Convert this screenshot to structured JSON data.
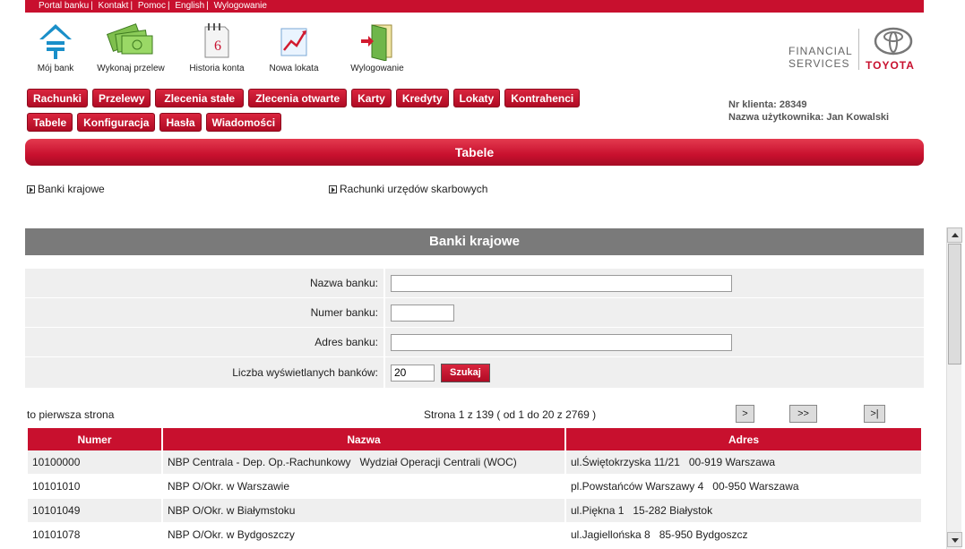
{
  "top_links": [
    "Portal banku",
    "Kontakt",
    "Pomoc",
    "English",
    "Wylogowanie"
  ],
  "icons": [
    {
      "label": "Mój bank",
      "icon": "home-icon"
    },
    {
      "label": "Wykonaj przelew",
      "icon": "money-icon"
    },
    {
      "label": "Historia konta",
      "icon": "calendar-icon"
    },
    {
      "label": "Nowa lokata",
      "icon": "chart-icon"
    },
    {
      "label": "Wylogowanie",
      "icon": "door-icon"
    }
  ],
  "logo": {
    "line1": "FINANCIAL",
    "line2": "SERVICES",
    "brand": "TOYOTA"
  },
  "menu": {
    "row1": [
      "Rachunki",
      "Przelewy",
      "Zlecenia stałe",
      "Zlecenia otwarte",
      "Karty",
      "Kredyty",
      "Lokaty",
      "Kontrahenci"
    ],
    "row2": [
      "Tabele",
      "Konfiguracja",
      "Hasła",
      "Wiadomości"
    ]
  },
  "user": {
    "client_no": "Nr klienta: 28349",
    "username": "Nazwa użytkownika: Jan Kowalski"
  },
  "section_title": "Tabele",
  "sublinks": [
    "Banki krajowe",
    "Rachunki urzędów skarbowych"
  ],
  "panel_title": "Banki krajowe",
  "form": {
    "name_label": "Nazwa banku:",
    "name_value": "",
    "number_label": "Numer banku:",
    "number_value": "",
    "address_label": "Adres banku:",
    "address_value": "",
    "count_label": "Liczba wyświetlanych banków:",
    "count_value": "20",
    "search_label": "Szukaj"
  },
  "pager": {
    "first_text": "to pierwsza strona",
    "info": "Strona 1 z 139 ( od 1 do 20 z 2769 )",
    "next": ">",
    "fast": ">>",
    "last": ">|"
  },
  "table": {
    "headers": [
      "Numer",
      "Nazwa",
      "Adres"
    ],
    "rows": [
      [
        "10100000",
        "NBP Centrala - Dep. Op.-Rachunkowy   Wydział Operacji Centrali (WOC)",
        "ul.Świętokrzyska 11/21   00-919 Warszawa"
      ],
      [
        "10101010",
        "NBP O/Okr. w Warszawie",
        "pl.Powstańców Warszawy 4   00-950 Warszawa"
      ],
      [
        "10101049",
        "NBP O/Okr. w Białymstoku",
        "ul.Piękna 1   15-282 Białystok"
      ],
      [
        "10101078",
        "NBP O/Okr. w Bydgoszczy",
        "ul.Jagiellońska 8   85-950 Bydgoszcz"
      ]
    ]
  }
}
